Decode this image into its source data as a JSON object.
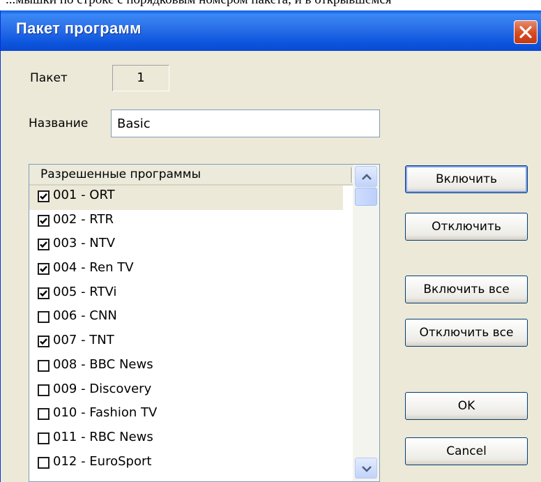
{
  "document_fragment": "...мышки по строке с порядковым номером пакета, и в открывшемся",
  "window": {
    "title": "Пакет программ"
  },
  "form": {
    "packet_label": "Пакет",
    "packet_value": "1",
    "name_label": "Название",
    "name_value": "Basic"
  },
  "list": {
    "header": "Разрешенные программы",
    "items": [
      {
        "label": "001 - ORT",
        "checked": true
      },
      {
        "label": "002 - RTR",
        "checked": true
      },
      {
        "label": "003 - NTV",
        "checked": true
      },
      {
        "label": "004 - Ren TV",
        "checked": true
      },
      {
        "label": "005 - RTVi",
        "checked": true
      },
      {
        "label": "006 - CNN",
        "checked": false
      },
      {
        "label": "007 - TNT",
        "checked": true
      },
      {
        "label": "008 - BBC News",
        "checked": false
      },
      {
        "label": "009 - Discovery",
        "checked": false
      },
      {
        "label": "010 - Fashion TV",
        "checked": false
      },
      {
        "label": "011 - RBC News",
        "checked": false
      },
      {
        "label": "012 - EuroSport",
        "checked": false
      }
    ]
  },
  "buttons": {
    "include": "Включить",
    "exclude": "Отключить",
    "include_all": "Включить все",
    "exclude_all": "Отключить все",
    "ok": "OK",
    "cancel": "Cancel"
  },
  "icons": {
    "close": "close-icon",
    "scroll_up": "chevron-up-icon",
    "scroll_down": "chevron-down-icon",
    "checkbox": "checkmark-icon"
  },
  "colors": {
    "titlebar": "#0a5fe4",
    "close_button": "#d84a22",
    "dialog_background": "#ece9d8",
    "field_border": "#7f9db9"
  }
}
